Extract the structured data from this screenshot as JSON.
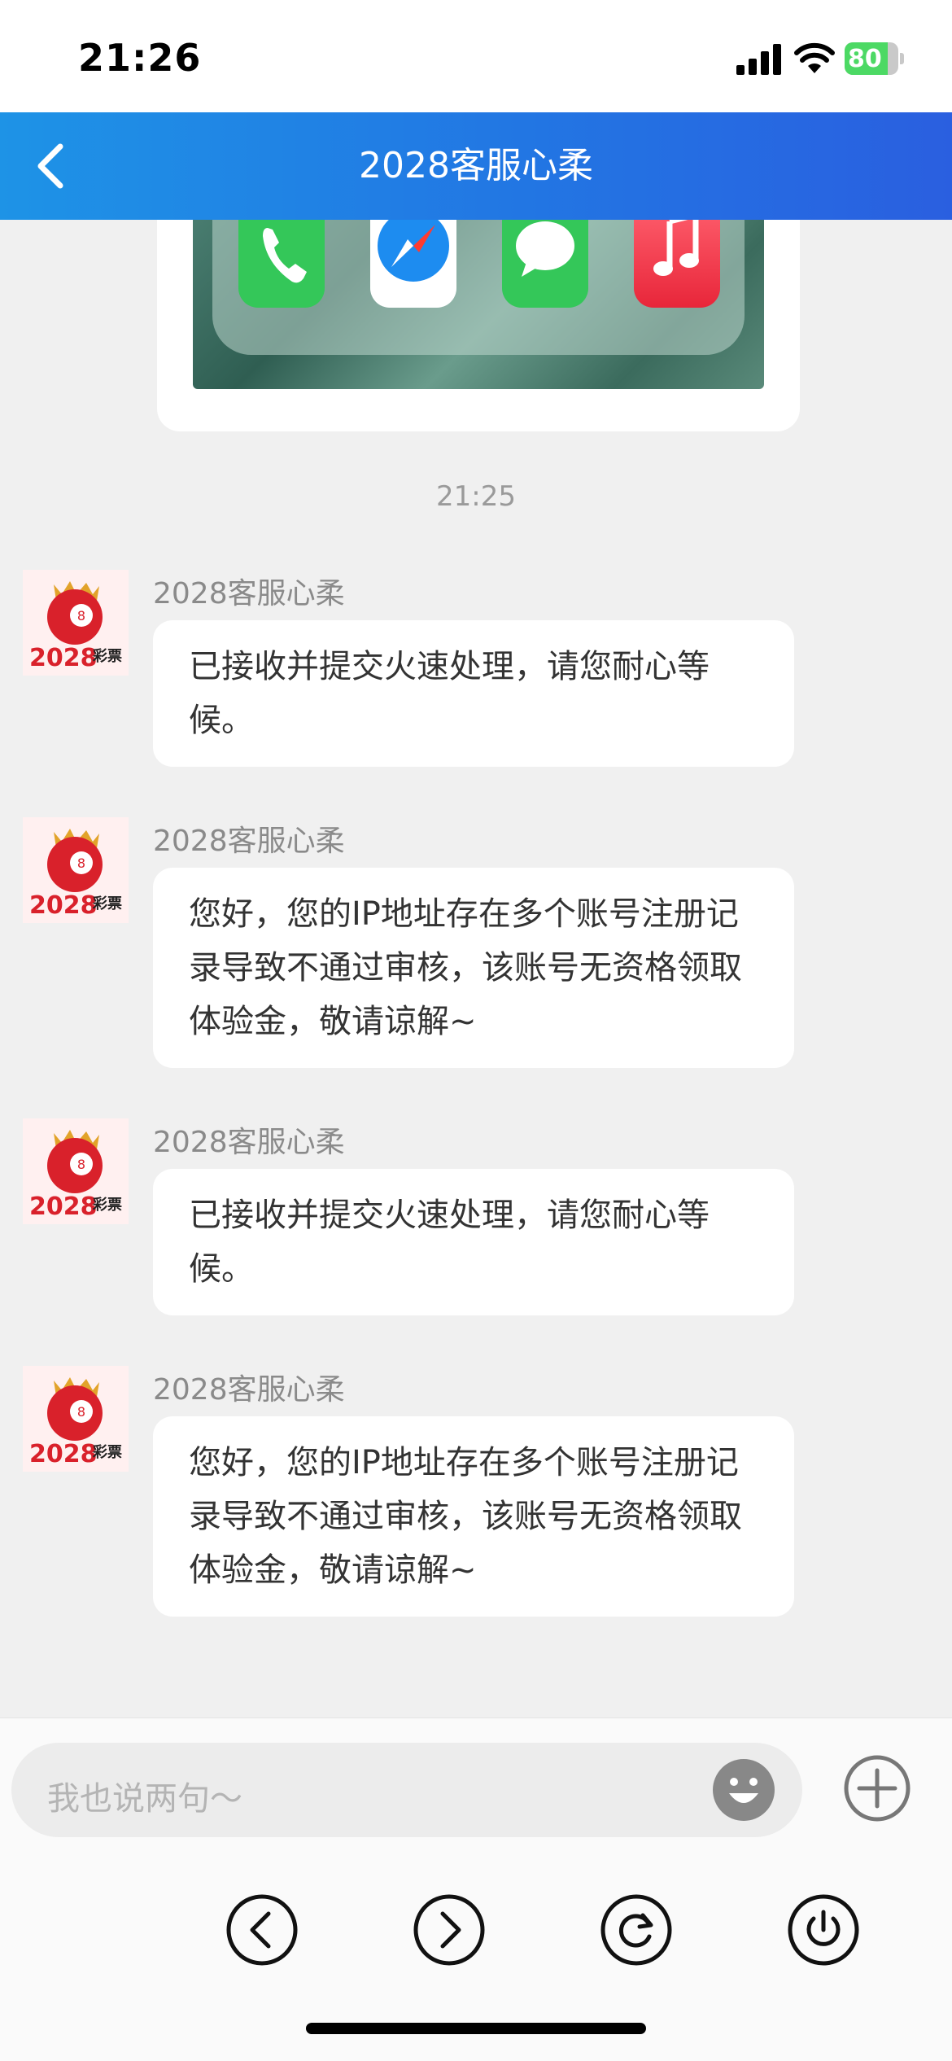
{
  "status_bar": {
    "time": "21:26",
    "battery_level": "80",
    "icons": [
      "signal-icon",
      "wifi-icon",
      "battery-charging-icon"
    ]
  },
  "nav": {
    "title": "2028客服心柔",
    "back_icon": "chevron-left-icon",
    "color": "#2276e3"
  },
  "chat": {
    "image_preview_icons": [
      "phone-app-icon",
      "safari-app-icon",
      "messages-app-icon",
      "music-app-icon"
    ],
    "timestamp": "21:25",
    "messages": [
      {
        "sender": "2028客服心柔",
        "text": "已接收并提交火速处理，请您耐心等候。"
      },
      {
        "sender": "2028客服心柔",
        "text": "您好，您的IP地址存在多个账号注册记录导致不通过审核，该账号无资格领取体验金，敬请谅解~"
      },
      {
        "sender": "2028客服心柔",
        "text": "已接收并提交火速处理，请您耐心等候。"
      },
      {
        "sender": "2028客服心柔",
        "text": "您好，您的IP地址存在多个账号注册记录导致不通过审核，该账号无资格领取体验金，敬请谅解~"
      }
    ],
    "avatar_logo_text": "2028彩票"
  },
  "input": {
    "placeholder": "我也说两句～",
    "emoji_icon": "emoji-icon",
    "plus_icon": "plus-circle-icon"
  },
  "controls": [
    "back-arrow-icon",
    "forward-arrow-icon",
    "refresh-icon",
    "power-icon"
  ]
}
